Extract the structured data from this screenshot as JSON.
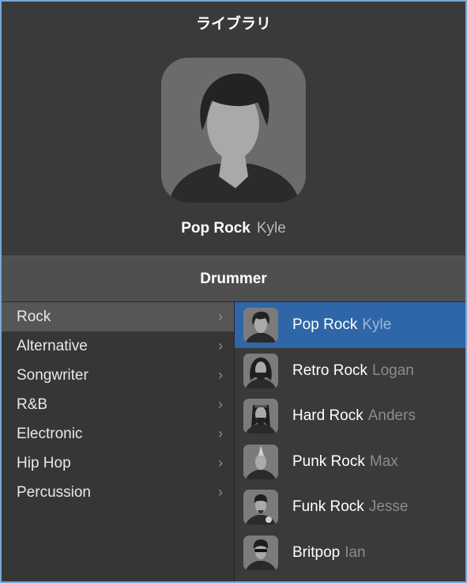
{
  "library": {
    "title": "ライブラリ"
  },
  "selected": {
    "style": "Pop Rock",
    "name": "Kyle"
  },
  "section": {
    "title": "Drummer"
  },
  "genres": [
    {
      "label": "Rock",
      "selected": true
    },
    {
      "label": "Alternative"
    },
    {
      "label": "Songwriter"
    },
    {
      "label": "R&B"
    },
    {
      "label": "Electronic"
    },
    {
      "label": "Hip Hop"
    },
    {
      "label": "Percussion"
    }
  ],
  "chevron": "›",
  "drummers": [
    {
      "style": "Pop Rock",
      "name": "Kyle",
      "selected": true
    },
    {
      "style": "Retro Rock",
      "name": "Logan"
    },
    {
      "style": "Hard Rock",
      "name": "Anders"
    },
    {
      "style": "Punk Rock",
      "name": "Max"
    },
    {
      "style": "Funk Rock",
      "name": "Jesse"
    },
    {
      "style": "Britpop",
      "name": "Ian"
    }
  ],
  "colors": {
    "selection": "#2f66a8",
    "background": "#3a3a3a"
  }
}
